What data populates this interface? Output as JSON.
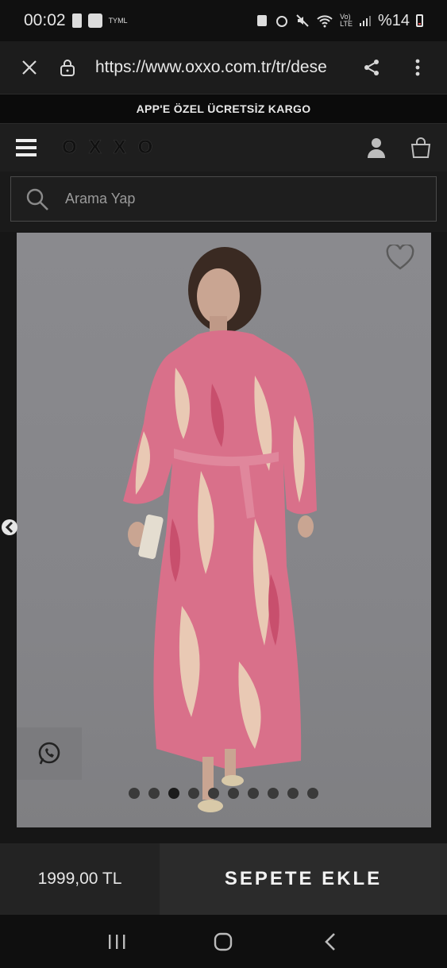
{
  "status_bar": {
    "time": "00:02",
    "carrier_tag": "TYML",
    "battery": "%14"
  },
  "browser": {
    "url": "https://www.oxxo.com.tr/tr/dese"
  },
  "promo": {
    "text": "APP'E ÖZEL ÜCRETSİZ KARGO"
  },
  "header": {
    "logo": "OXXO"
  },
  "search": {
    "placeholder": "Arama Yap"
  },
  "gallery": {
    "total_images": 10,
    "active_index": 2
  },
  "product": {
    "price": "1999,00 TL",
    "add_to_cart_label": "SEPETE EKLE"
  },
  "colors": {
    "dress_pink": "#d9708a",
    "dress_cream": "#e9c9b4",
    "backdrop": "#88888c"
  }
}
